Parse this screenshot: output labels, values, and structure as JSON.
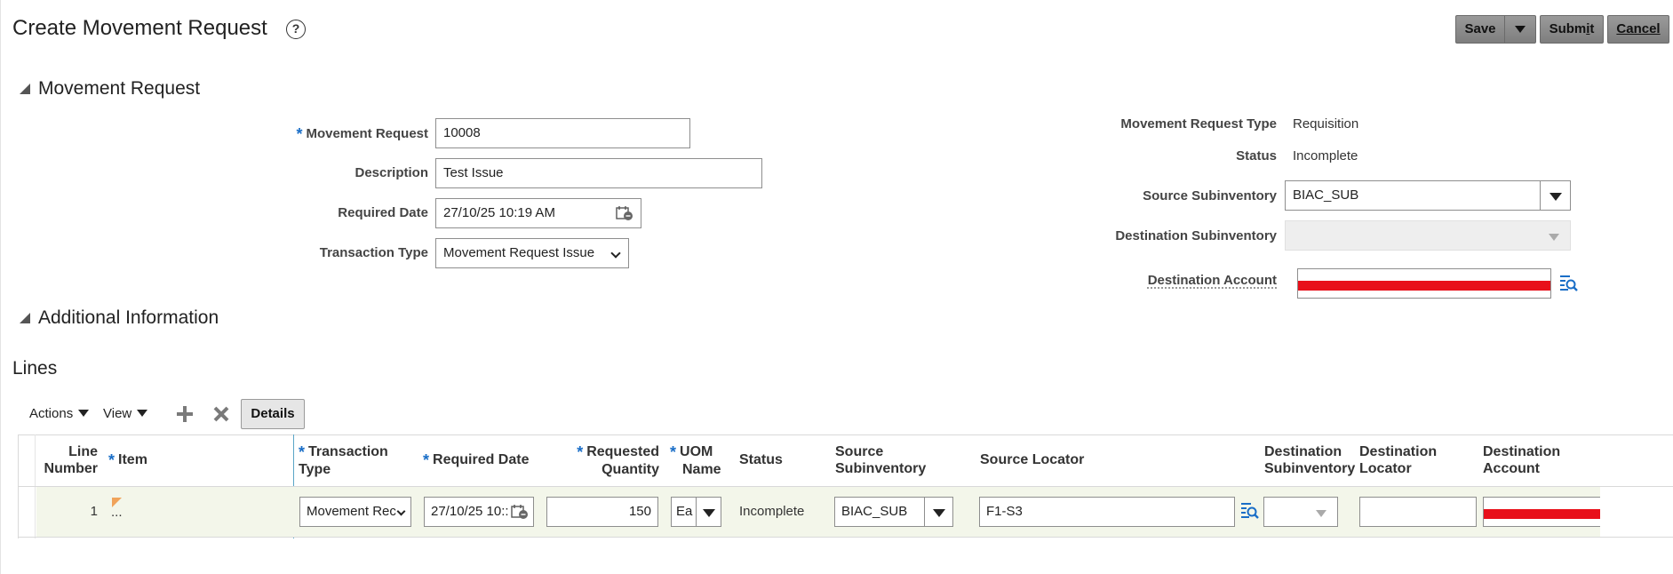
{
  "header": {
    "title": "Create Movement Request",
    "help_icon": "?",
    "buttons": {
      "save": "Save",
      "submit": "Submit",
      "cancel": "Cancel"
    }
  },
  "sections": {
    "movement_request": "Movement Request",
    "additional_information": "Additional Information",
    "lines": "Lines"
  },
  "form": {
    "movement_request": {
      "label": "Movement Request",
      "value": "10008"
    },
    "description": {
      "label": "Description",
      "value": "Test Issue"
    },
    "required_date": {
      "label": "Required Date",
      "value": "27/10/25 10:19 AM"
    },
    "transaction_type": {
      "label": "Transaction Type",
      "value": "Movement Request Issue"
    },
    "movement_request_type": {
      "label": "Movement Request Type",
      "value": "Requisition"
    },
    "status": {
      "label": "Status",
      "value": "Incomplete"
    },
    "source_subinventory": {
      "label": "Source Subinventory",
      "value": "BIAC_SUB"
    },
    "destination_subinventory": {
      "label": "Destination Subinventory",
      "value": ""
    },
    "destination_account": {
      "label": "Destination Account",
      "value": ""
    }
  },
  "lines_toolbar": {
    "actions": "Actions",
    "view": "View",
    "details": "Details"
  },
  "table": {
    "headers": {
      "line_number": [
        "Line",
        "Number"
      ],
      "item": "Item",
      "transaction_type": [
        "Transaction",
        "Type"
      ],
      "required_date": "Required Date",
      "requested_quantity": [
        "Requested",
        "Quantity"
      ],
      "uom_name": [
        "UOM",
        "Name"
      ],
      "status": "Status",
      "source_subinventory": [
        "Source",
        "Subinventory"
      ],
      "source_locator": "Source Locator",
      "destination_subinventory": [
        "Destination",
        "Subinventory"
      ],
      "destination_locator": [
        "Destination",
        "Locator"
      ],
      "destination_account": [
        "Destination",
        "Account"
      ]
    },
    "rows": [
      {
        "line_number": "1",
        "item": "...",
        "transaction_type": "Movement Rec",
        "required_date": "27/10/25 10::",
        "requested_quantity": "150",
        "uom_name": "Ea",
        "status": "Incomplete",
        "source_subinventory": "BIAC_SUB",
        "source_locator": "F1-S3"
      }
    ]
  },
  "colors": {
    "accent_blue": "#1a6ec7",
    "redaction": "#e8101a",
    "row_highlight": "#f3f6ea",
    "button_gray": "#8c8c8c"
  }
}
